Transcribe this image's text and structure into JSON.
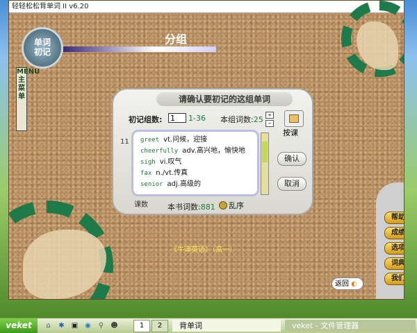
{
  "window": {
    "title": "轻轻松松背单词 II  v6.20"
  },
  "app": {
    "logo_text_line1": "单词",
    "logo_text_line2": "初记",
    "page_title": "分组",
    "menu_tab": "MENU主菜单",
    "book_name": "《牛津英语》（高一）",
    "back_label": "返回"
  },
  "dialog": {
    "title": "请确认要初记的这组单词",
    "group_count_label": "初记组数:",
    "group_count_value": "1",
    "group_count_range": "1-36",
    "per_group_label": "本组词数:",
    "per_group_value": "25",
    "index_number": "11",
    "batch_label": "课数",
    "book_total_label": "本书词数:",
    "book_total_value": "881",
    "shuffle_label": "乱序",
    "by_lesson_label": "按课",
    "confirm_label": "确认",
    "cancel_label": "取消",
    "words": [
      {
        "en": "greet",
        "zh": "vt.问候，迎接"
      },
      {
        "en": "cheerfully",
        "zh": "adv.高兴地，愉快地"
      },
      {
        "en": "sigh",
        "zh": "vi.叹气"
      },
      {
        "en": "fax",
        "zh": "n./vt.传真"
      },
      {
        "en": "senior",
        "zh": "adj.高级的"
      }
    ]
  },
  "side_menu": [
    "帮助",
    "成绩",
    "选项",
    "词典",
    "我们"
  ],
  "taskbar": {
    "start": "veket",
    "tray_icons": [
      "home-icon",
      "star-icon",
      "terminal-icon",
      "globe-icon",
      "search-icon",
      "penguin-icon"
    ],
    "workspaces": [
      "1",
      "2"
    ],
    "tasks": [
      "背单词",
      "veket - 文件管理器"
    ]
  }
}
